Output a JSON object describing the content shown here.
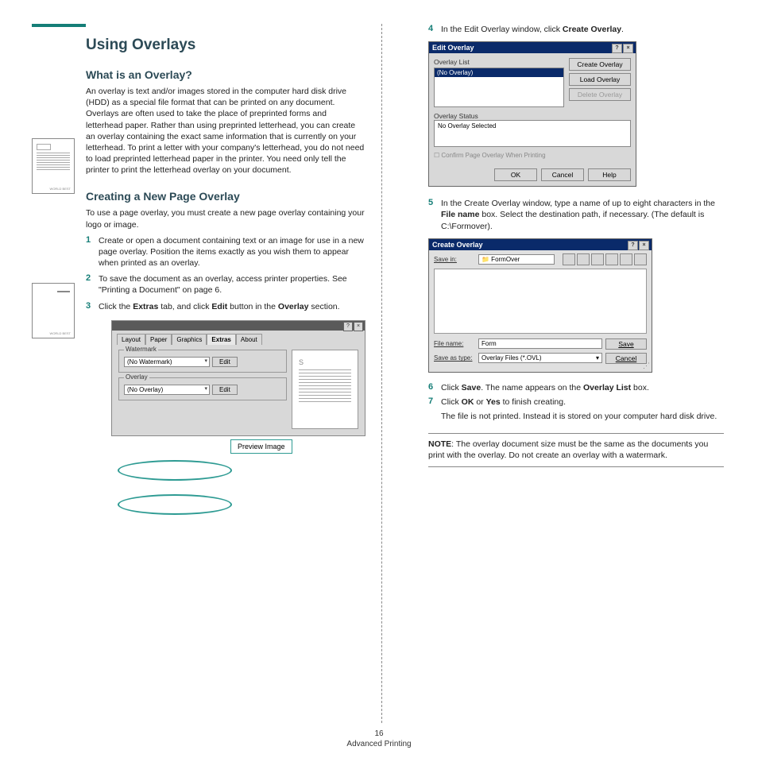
{
  "footer": {
    "page_number": "16",
    "section": "Advanced Printing"
  },
  "left": {
    "title": "Using Overlays",
    "h2a": "What is an Overlay?",
    "p1": "An overlay is text and/or images stored in the computer hard disk drive (HDD) as a special file format that can be printed on any document. Overlays are often used to take the place of preprinted forms and letterhead paper. Rather than using preprinted letterhead, you can create an overlay containing the exact same information that is currently on your letterhead. To print a letter with your company's letterhead, you do not need to load preprinted letterhead paper in the printer. You need only tell the printer to print the letterhead overlay on your document.",
    "h2b": "Creating a New Page Overlay",
    "p2": "To use a page overlay, you must create a new page overlay containing your logo or image.",
    "steps": {
      "s1": "Create or open a document containing text or an image for use in a new page overlay. Position the items exactly as you wish them to appear when printed as an overlay.",
      "s2": "To save the document as an overlay, access printer properties. See \"Printing a Document\" on page 6.",
      "s3a": "Click the ",
      "s3b": "Extras",
      "s3c": " tab, and click ",
      "s3d": "Edit",
      "s3e": " button in the ",
      "s3f": "Overlay",
      "s3g": " section."
    },
    "fig1": {
      "tabs": [
        "Layout",
        "Paper",
        "Graphics",
        "Extras",
        "About"
      ],
      "watermark_label": "Watermark",
      "watermark_value": "(No Watermark)",
      "overlay_label": "Overlay",
      "overlay_value": "(No Overlay)",
      "edit": "Edit",
      "preview_label": "Preview Image",
      "preview_letter": "S"
    },
    "thumb_label": "WORLD BEST"
  },
  "right": {
    "s4a": "In the Edit Overlay window, click ",
    "s4b": "Create Overlay",
    "s4c": ".",
    "fig2": {
      "title": "Edit Overlay",
      "list_label": "Overlay List",
      "list_item": "(No Overlay)",
      "btn_create": "Create Overlay",
      "btn_load": "Load Overlay",
      "btn_delete": "Delete Overlay",
      "status_label": "Overlay Status",
      "status_text": "No Overlay Selected",
      "checkbox": "Confirm Page Overlay When Printing",
      "ok": "OK",
      "cancel": "Cancel",
      "help": "Help"
    },
    "s5a": "In the Create Overlay window, type a name of up to eight characters in the ",
    "s5b": "File name",
    "s5c": " box. Select the destination path, if necessary. (The default is C:\\Formover).",
    "fig3": {
      "title": "Create Overlay",
      "savein_label": "Save in:",
      "savein_value": "📁 FormOver",
      "filename_label": "File name:",
      "filename_value": "Form",
      "savetype_label": "Save as type:",
      "savetype_value": "Overlay Files (*.OVL)",
      "save": "Save",
      "cancel": "Cancel"
    },
    "s6a": "Click ",
    "s6b": "Save",
    "s6c": ". The name appears on the ",
    "s6d": "Overlay List",
    "s6e": " box.",
    "s7a": "Click ",
    "s7b": "OK",
    "s7c": " or ",
    "s7d": "Yes",
    "s7e": " to finish creating.",
    "s7_extra": "The file is not printed. Instead it is stored on your computer hard disk drive.",
    "note_label": "NOTE",
    "note_text": ": The overlay document size must be the same as the documents you print with the overlay. Do not create an overlay with a watermark."
  }
}
